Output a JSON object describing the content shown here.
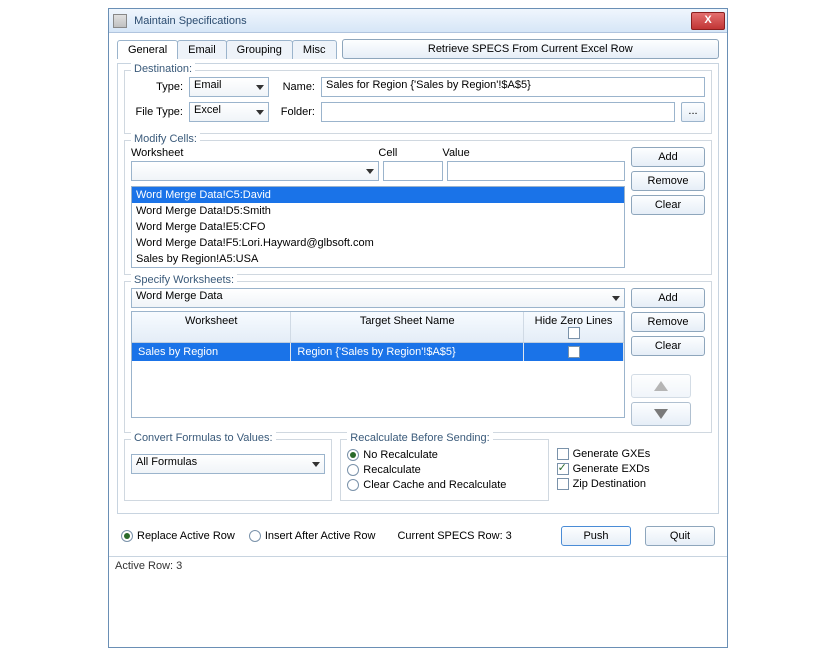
{
  "window": {
    "title": "Maintain  Specifications"
  },
  "tabs": [
    "General",
    "Email",
    "Grouping",
    "Misc"
  ],
  "retrieve_label": "Retrieve SPECS From Current Excel Row",
  "destination": {
    "legend": "Destination:",
    "type_label": "Type:",
    "type_value": "Email",
    "name_label": "Name:",
    "name_value": "Sales for Region {'Sales by Region'!$A$5}",
    "filetype_label": "File Type:",
    "filetype_value": "Excel",
    "folder_label": "Folder:",
    "folder_value": ""
  },
  "modify": {
    "legend": "Modify Cells:",
    "worksheet_hdr": "Worksheet",
    "cell_hdr": "Cell",
    "value_hdr": "Value",
    "worksheet_value": "",
    "cell_value": "",
    "value_value": "",
    "items": [
      "Word Merge Data!C5:David",
      "Word Merge Data!D5:Smith",
      "Word Merge Data!E5:CFO",
      "Word Merge Data!F5:Lori.Hayward@glbsoft.com",
      "Sales by Region!A5:USA"
    ]
  },
  "btns": {
    "add": "Add",
    "remove": "Remove",
    "clear": "Clear"
  },
  "specify": {
    "legend": "Specify Worksheets:",
    "select_value": "Word Merge Data",
    "col_ws": "Worksheet",
    "col_tgt": "Target Sheet Name",
    "col_hz": "Hide Zero Lines",
    "rows": [
      {
        "ws": "Sales by Region",
        "tgt": "Region {'Sales by Region'!$A$5}",
        "hz": false
      }
    ]
  },
  "convert": {
    "legend": "Convert Formulas to Values:",
    "value": "All Formulas"
  },
  "recalc": {
    "legend": "Recalculate Before Sending:",
    "opts": [
      "No Recalculate",
      "Recalculate",
      "Clear Cache and Recalculate"
    ],
    "selected": 0
  },
  "generate": {
    "gxe": "Generate GXEs",
    "exd": "Generate EXDs",
    "zip": "Zip Destination",
    "gxe_checked": false,
    "exd_checked": true,
    "zip_checked": false
  },
  "bottom": {
    "replace": "Replace Active Row",
    "insert": "Insert After Active Row",
    "selected": "replace",
    "current_label": "Current SPECS Row: 3",
    "push": "Push",
    "quit": "Quit"
  },
  "status": "Active Row: 3"
}
